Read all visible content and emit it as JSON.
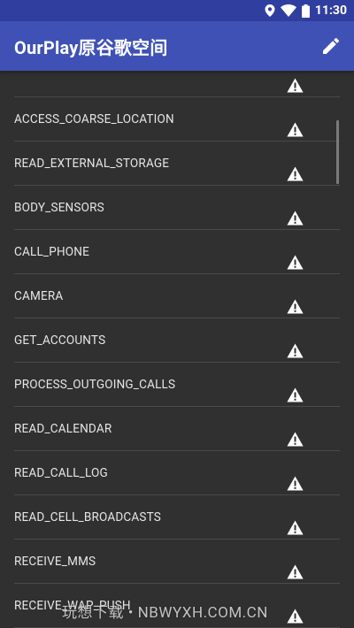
{
  "status_bar": {
    "time": "11:30",
    "icons": [
      "location-icon",
      "wifi-icon",
      "battery-icon"
    ],
    "color": "#303F9F"
  },
  "app_bar": {
    "title": "OurPlay原谷歌空间",
    "action_icon": "edit-pencil-icon",
    "color": "#3F51B5"
  },
  "permissions": [
    {
      "label": ""
    },
    {
      "label": "ACCESS_COARSE_LOCATION"
    },
    {
      "label": "READ_EXTERNAL_STORAGE"
    },
    {
      "label": "BODY_SENSORS"
    },
    {
      "label": "CALL_PHONE"
    },
    {
      "label": "CAMERA"
    },
    {
      "label": "GET_ACCOUNTS"
    },
    {
      "label": "PROCESS_OUTGOING_CALLS"
    },
    {
      "label": "READ_CALENDAR"
    },
    {
      "label": "READ_CALL_LOG"
    },
    {
      "label": "READ_CELL_BROADCASTS"
    },
    {
      "label": "RECEIVE_MMS"
    },
    {
      "label": "RECEIVE_WAP_PUSH"
    }
  ],
  "row_icon": "warning-icon",
  "watermark": "玩想下载 • NBWYXH.COM.CN"
}
